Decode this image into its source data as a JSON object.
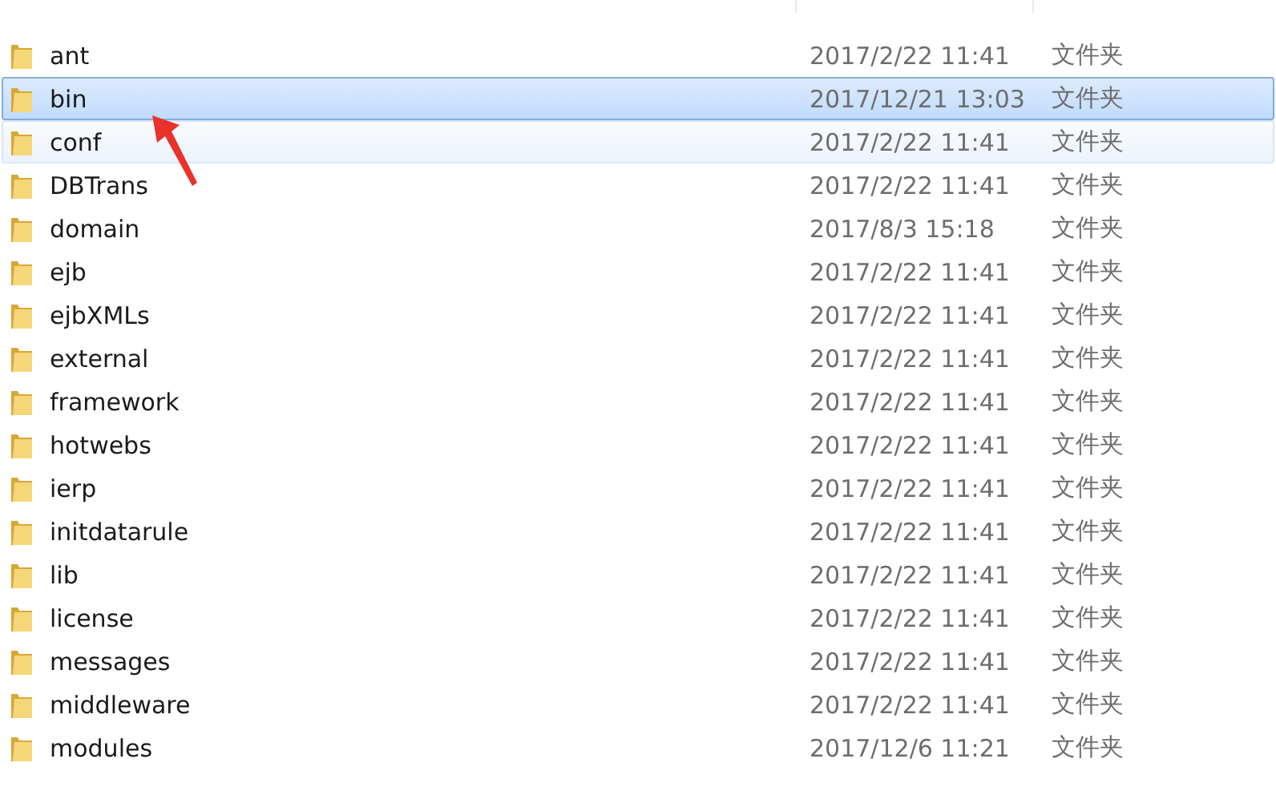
{
  "rows": [
    {
      "name": "ant",
      "modified": "2017/2/22 11:41",
      "type": "文件夹",
      "selected": false,
      "hovered": false
    },
    {
      "name": "bin",
      "modified": "2017/12/21 13:03",
      "type": "文件夹",
      "selected": true,
      "hovered": false
    },
    {
      "name": "conf",
      "modified": "2017/2/22 11:41",
      "type": "文件夹",
      "selected": false,
      "hovered": true
    },
    {
      "name": "DBTrans",
      "modified": "2017/2/22 11:41",
      "type": "文件夹",
      "selected": false,
      "hovered": false
    },
    {
      "name": "domain",
      "modified": "2017/8/3 15:18",
      "type": "文件夹",
      "selected": false,
      "hovered": false
    },
    {
      "name": "ejb",
      "modified": "2017/2/22 11:41",
      "type": "文件夹",
      "selected": false,
      "hovered": false
    },
    {
      "name": "ejbXMLs",
      "modified": "2017/2/22 11:41",
      "type": "文件夹",
      "selected": false,
      "hovered": false
    },
    {
      "name": "external",
      "modified": "2017/2/22 11:41",
      "type": "文件夹",
      "selected": false,
      "hovered": false
    },
    {
      "name": "framework",
      "modified": "2017/2/22 11:41",
      "type": "文件夹",
      "selected": false,
      "hovered": false
    },
    {
      "name": "hotwebs",
      "modified": "2017/2/22 11:41",
      "type": "文件夹",
      "selected": false,
      "hovered": false
    },
    {
      "name": "ierp",
      "modified": "2017/2/22 11:41",
      "type": "文件夹",
      "selected": false,
      "hovered": false
    },
    {
      "name": "initdatarule",
      "modified": "2017/2/22 11:41",
      "type": "文件夹",
      "selected": false,
      "hovered": false
    },
    {
      "name": "lib",
      "modified": "2017/2/22 11:41",
      "type": "文件夹",
      "selected": false,
      "hovered": false
    },
    {
      "name": "license",
      "modified": "2017/2/22 11:41",
      "type": "文件夹",
      "selected": false,
      "hovered": false
    },
    {
      "name": "messages",
      "modified": "2017/2/22 11:41",
      "type": "文件夹",
      "selected": false,
      "hovered": false
    },
    {
      "name": "middleware",
      "modified": "2017/2/22 11:41",
      "type": "文件夹",
      "selected": false,
      "hovered": false
    },
    {
      "name": "modules",
      "modified": "2017/12/6 11:21",
      "type": "文件夹",
      "selected": false,
      "hovered": false
    }
  ]
}
